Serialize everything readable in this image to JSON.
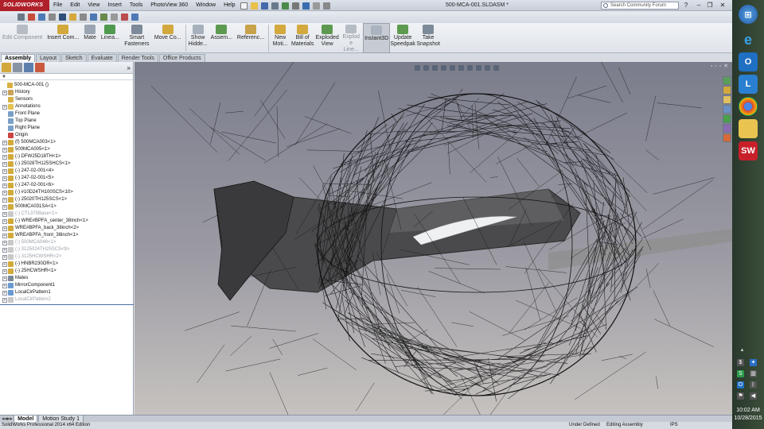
{
  "app": {
    "logo_text": "SOLIDWORKS",
    "menu": [
      "File",
      "Edit",
      "View",
      "Insert",
      "Tools",
      "PhotoView 360",
      "Window",
      "Help"
    ],
    "doc_title": "500-MCA-001.SLDASM *",
    "search_placeholder": "Search Community Forum"
  },
  "commands": [
    {
      "label": "Edit Component",
      "dim": true
    },
    {
      "label": "Insert Com...",
      "dim": false
    },
    {
      "label": "Mate",
      "dim": false
    },
    {
      "label": "Linea...",
      "dim": false
    },
    {
      "label": "Smart Fasteners",
      "dim": false
    },
    {
      "label": "Move Co...",
      "dim": false
    },
    {
      "label": "Show Hidde...",
      "dim": false
    },
    {
      "label": "Assem...",
      "dim": false
    },
    {
      "label": "Referenc...",
      "dim": false
    },
    {
      "label": "New Moti...",
      "dim": false
    },
    {
      "label": "Bill of Materials",
      "dim": false
    },
    {
      "label": "Exploded View",
      "dim": false
    },
    {
      "label": "Explod e Line...",
      "dim": true
    },
    {
      "label": "Instant3D",
      "dim": false,
      "active": true
    },
    {
      "label": "Update Speedpak",
      "dim": false
    },
    {
      "label": "Take Snapshot",
      "dim": false
    }
  ],
  "tabs": [
    "Assembly",
    "Layout",
    "Sketch",
    "Evaluate",
    "Render Tools",
    "Office Products"
  ],
  "tree": [
    {
      "label": "500-MCA-001  ()",
      "exp": false,
      "color": "#d8b043",
      "indent": 0
    },
    {
      "label": "History",
      "exp": true,
      "color": "#c9a25a",
      "indent": 1
    },
    {
      "label": "Sensors",
      "exp": false,
      "color": "#d6b14a",
      "indent": 1
    },
    {
      "label": "Annotations",
      "exp": true,
      "color": "#e3c150",
      "indent": 1
    },
    {
      "label": "Front Plane",
      "exp": false,
      "color": "#7aa0c8",
      "indent": 1
    },
    {
      "label": "Top Plane",
      "exp": false,
      "color": "#7aa0c8",
      "indent": 1
    },
    {
      "label": "Right Plane",
      "exp": false,
      "color": "#7aa0c8",
      "indent": 1
    },
    {
      "label": "Origin",
      "exp": false,
      "color": "#c44",
      "indent": 1
    },
    {
      "label": "(f) 500MCA003<1>",
      "exp": true,
      "color": "#d2aa3a",
      "indent": 1
    },
    {
      "label": "500MCA005<1>",
      "exp": true,
      "color": "#d2aa3a",
      "indent": 1
    },
    {
      "label": "(-) DFW25D18TH<1>",
      "exp": true,
      "color": "#d2aa3a",
      "indent": 1
    },
    {
      "label": "(-) 25028TH125SHCS<1>",
      "exp": true,
      "color": "#d2aa3a",
      "indent": 1
    },
    {
      "label": "(-) 247-02-001<4>",
      "exp": true,
      "color": "#d2aa3a",
      "indent": 1
    },
    {
      "label": "(-) 247-02-001<5>",
      "exp": true,
      "color": "#d2aa3a",
      "indent": 1
    },
    {
      "label": "(-) 247-02-001<6>",
      "exp": true,
      "color": "#d2aa3a",
      "indent": 1
    },
    {
      "label": "(-) #10D24TH100SCS<10>",
      "exp": true,
      "color": "#d2aa3a",
      "indent": 1
    },
    {
      "label": "(-) 25020TH125SCS<1>",
      "exp": true,
      "color": "#d2aa3a",
      "indent": 1
    },
    {
      "label": "500MCA031SA<1>",
      "exp": true,
      "color": "#d2aa3a",
      "indent": 1
    },
    {
      "label": "(-) CTL375Base<1>",
      "exp": true,
      "color": "#c8c8c8",
      "indent": 1,
      "dim": true
    },
    {
      "label": "(-) WRE#BPFA_center_38inch<1>",
      "exp": true,
      "color": "#d2aa3a",
      "indent": 1
    },
    {
      "label": "WRE#BPFA_back_38inch<2>",
      "exp": true,
      "color": "#d2aa3a",
      "indent": 1
    },
    {
      "label": "WRE#BPFA_front_38inch<1>",
      "exp": true,
      "color": "#d2aa3a",
      "indent": 1
    },
    {
      "label": "(-) 500MCA048<1>",
      "exp": true,
      "color": "#c8c8c8",
      "indent": 1,
      "dim": true
    },
    {
      "label": "(-) 3125024TH25SCS<9>",
      "exp": true,
      "color": "#c8c8c8",
      "indent": 1,
      "dim": true
    },
    {
      "label": "(-) 3125HCWSHR<2>",
      "exp": true,
      "color": "#c8c8c8",
      "indent": 1,
      "dim": true
    },
    {
      "label": "(-) HNBR230OR<1>",
      "exp": true,
      "color": "#d2aa3a",
      "indent": 1
    },
    {
      "label": "(-) 25HCWSHR<1>",
      "exp": true,
      "color": "#d2aa3a",
      "indent": 1
    },
    {
      "label": "Mates",
      "exp": true,
      "color": "#7a8796",
      "indent": 1
    },
    {
      "label": "MirrorComponent1",
      "exp": true,
      "color": "#6a9ad0",
      "indent": 1
    },
    {
      "label": "LocalCirPattern1",
      "exp": true,
      "color": "#6a9ad0",
      "indent": 1
    },
    {
      "label": "LocalCirPattern2",
      "exp": true,
      "color": "#c8c8c8",
      "indent": 1,
      "dim": true
    }
  ],
  "bottom_tabs": [
    "Model",
    "Motion Study 1"
  ],
  "status": {
    "left": "SolidWorks Professional 2014 x64 Edition",
    "state": "Under Defined",
    "mode": "Editing Assembly",
    "units": "IPS"
  },
  "taskbar": {
    "time": "10:02 AM",
    "date": "10/28/2015"
  }
}
